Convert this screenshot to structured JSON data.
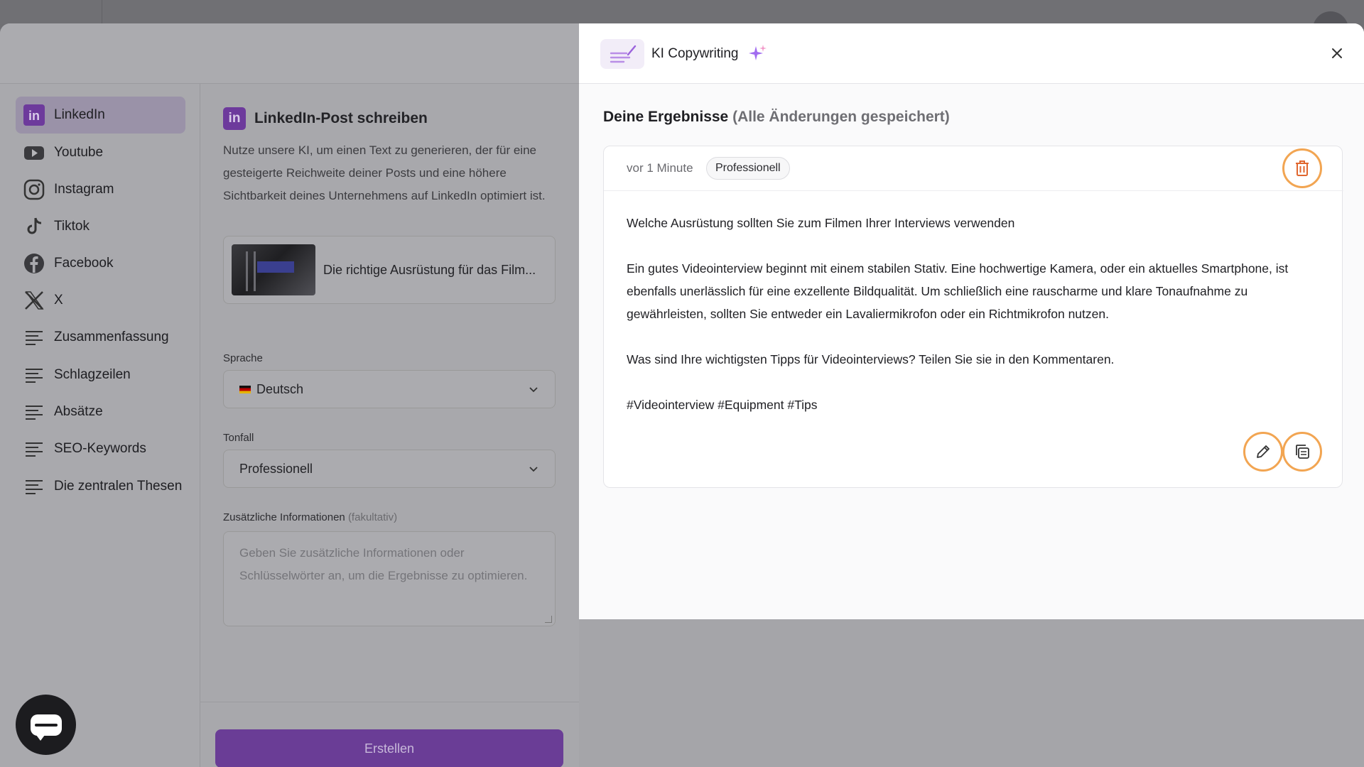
{
  "sidebar": {
    "items": [
      {
        "label": "LinkedIn",
        "icon": "linkedin-icon",
        "active": true
      },
      {
        "label": "Youtube",
        "icon": "youtube-icon"
      },
      {
        "label": "Instagram",
        "icon": "instagram-icon"
      },
      {
        "label": "Tiktok",
        "icon": "tiktok-icon"
      },
      {
        "label": "Facebook",
        "icon": "facebook-icon"
      },
      {
        "label": "X",
        "icon": "x-icon"
      },
      {
        "label": "Zusammenfassung",
        "icon": "text-lines-icon"
      },
      {
        "label": "Schlagzeilen",
        "icon": "text-lines-icon"
      },
      {
        "label": "Absätze",
        "icon": "text-lines-icon"
      },
      {
        "label": "SEO-Keywords",
        "icon": "text-lines-icon"
      },
      {
        "label": "Die zentralen Thesen",
        "icon": "text-lines-icon"
      }
    ]
  },
  "form": {
    "badge": "in",
    "title": "LinkedIn-Post schreiben",
    "description": "Nutze unsere KI, um einen Text zu generieren, der für eine gesteigerte Reichweite deiner Posts und eine höhere Sichtbarkeit deines Unternehmens auf LinkedIn optimiert ist.",
    "video_title": "Die richtige Ausrüstung für das Film...",
    "language_label": "Sprache",
    "language_value": "Deutsch",
    "tone_label": "Tonfall",
    "tone_value": "Professionell",
    "extra_label": "Zusätzliche Informationen",
    "extra_optional": "(fakultativ)",
    "extra_placeholder": "Geben Sie zusätzliche Informationen oder Schlüsselwörter an, um die Ergebnisse zu optimieren.",
    "create_label": "Erstellen"
  },
  "panel": {
    "title": "KI Copywriting",
    "results_title": "Deine Ergebnisse",
    "results_saved": "(Alle Änderungen gespeichert)",
    "result": {
      "time": "vor 1 Minute",
      "tone_badge": "Professionell",
      "paragraphs": [
        "Welche Ausrüstung sollten Sie zum Filmen Ihrer Interviews verwenden",
        "Ein gutes Videointerview beginnt mit einem stabilen Stativ. Eine hochwertige Kamera, oder ein aktuelles Smartphone, ist ebenfalls unerlässlich für eine exzellente Bildqualität. Um schließlich eine rauscharme und klare Tonaufnahme zu gewährleisten, sollten Sie entweder ein Lavaliermikrofon oder ein Richtmikrofon nutzen.",
        "Was sind Ihre wichtigsten Tipps für Videointerviews? Teilen Sie sie in den Kommentaren.",
        "#Videointerview #Equipment #Tips"
      ]
    }
  },
  "colors": {
    "accent": "#7b3fc0",
    "highlight_ring": "#f2a552",
    "trash": "#e0662e"
  }
}
